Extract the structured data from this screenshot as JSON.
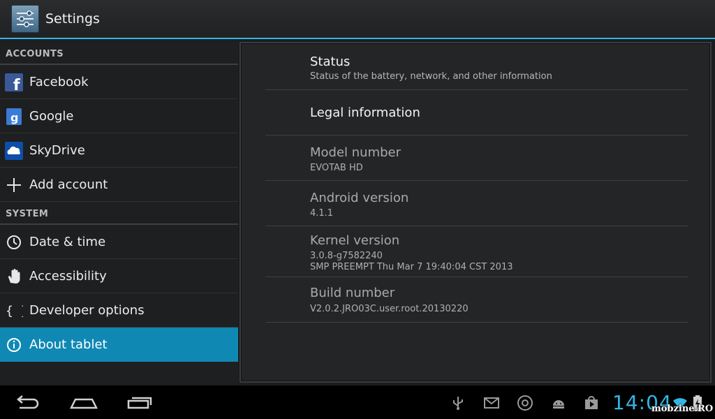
{
  "app": {
    "title": "Settings",
    "icon": "settings-sliders-icon"
  },
  "sidebar": {
    "accounts_header": "ACCOUNTS",
    "system_header": "SYSTEM",
    "accounts": [
      {
        "label": "Facebook",
        "icon": "facebook-icon"
      },
      {
        "label": "Google",
        "icon": "google-icon"
      },
      {
        "label": "SkyDrive",
        "icon": "skydrive-icon"
      },
      {
        "label": "Add account",
        "icon": "plus-icon"
      }
    ],
    "system": [
      {
        "label": "Date & time",
        "icon": "clock-icon"
      },
      {
        "label": "Accessibility",
        "icon": "hand-icon"
      },
      {
        "label": "Developer options",
        "icon": "braces-icon"
      },
      {
        "label": "About tablet",
        "icon": "info-icon",
        "selected": true
      }
    ]
  },
  "about": {
    "status": {
      "title": "Status",
      "summary": "Status of the battery, network, and other information"
    },
    "legal": {
      "title": "Legal information"
    },
    "model": {
      "title": "Model number",
      "summary": "EVOTAB HD"
    },
    "android": {
      "title": "Android version",
      "summary": "4.1.1"
    },
    "kernel": {
      "title": "Kernel version",
      "summary_line1": "3.0.8-g7582240",
      "summary_line2": "SMP PREEMPT Thu Mar 7 19:40:04 CST 2013"
    },
    "build": {
      "title": "Build number",
      "summary": "V2.0.2.JRO03C.user.root.20130220"
    }
  },
  "statusbar": {
    "time": "14:04",
    "icons": [
      "usb-icon",
      "gmail-icon",
      "chrome-icon",
      "android-icon",
      "play-store-icon",
      "wifi-icon",
      "battery-charging-icon"
    ]
  },
  "navbar": {
    "buttons": [
      "back-button",
      "home-button",
      "recent-apps-button"
    ]
  },
  "watermark": "mobzine.RO",
  "colors": {
    "accent": "#33b5e5",
    "selected": "#0f88b4",
    "background": "#1b1d1f"
  }
}
